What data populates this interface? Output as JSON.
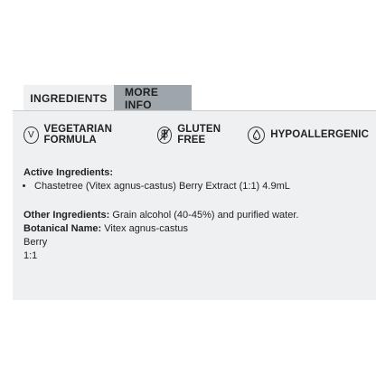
{
  "tabs": [
    {
      "label": "INGREDIENTS",
      "active": true
    },
    {
      "label": "MORE INFO",
      "active": false
    }
  ],
  "badges": [
    {
      "icon": "vegetarian-v-icon",
      "label": "VEGETARIAN FORMULA"
    },
    {
      "icon": "wheat-crossed-icon",
      "label": "GLUTEN FREE"
    },
    {
      "icon": "droplet-icon",
      "label": "HYPOALLERGENIC"
    }
  ],
  "active_ingredients": {
    "heading": "Active Ingredients:",
    "items": [
      "Chastetree (Vitex agnus-castus) Berry Extract (1:1) 4.9mL"
    ]
  },
  "other_ingredients": {
    "heading": "Other Ingredients:",
    "value": " Grain alcohol (40-45%) and purified water."
  },
  "botanical_name": {
    "heading": "Botanical Name:",
    "value": " Vitex agnus-castus"
  },
  "part": "Berry",
  "ratio": "1:1",
  "colors": {
    "panel_bg": "#eef0f2",
    "inactive_tab": "#9fa6ab"
  }
}
